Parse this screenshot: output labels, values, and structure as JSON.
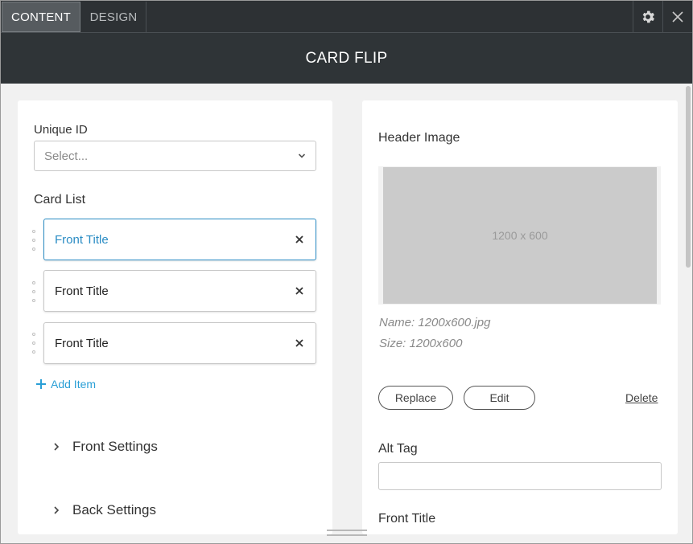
{
  "tabs": {
    "content": "CONTENT",
    "design": "DESIGN"
  },
  "header": {
    "title": "CARD FLIP"
  },
  "left": {
    "unique_id_label": "Unique ID",
    "unique_id_placeholder": "Select...",
    "card_list_label": "Card List",
    "cards": [
      {
        "title": "Front Title",
        "active": true
      },
      {
        "title": "Front Title",
        "active": false
      },
      {
        "title": "Front Title",
        "active": false
      }
    ],
    "add_item": "Add Item",
    "sections": [
      "Front Settings",
      "Back Settings"
    ]
  },
  "right": {
    "header_image_label": "Header Image",
    "image_placeholder": "1200 x 600",
    "image_name": "Name: 1200x600.jpg",
    "image_size": "Size: 1200x600",
    "replace_label": "Replace",
    "edit_label": "Edit",
    "delete_label": "Delete",
    "alt_tag_label": "Alt Tag",
    "alt_tag_value": "",
    "front_title_label": "Front Title"
  },
  "colors": {
    "accent": "#2a9fd6",
    "dark_bar": "#2f3437",
    "active_card_border": "#2a8cc4"
  },
  "icons": {
    "settings": "gear-icon",
    "close": "close-icon",
    "dropdown": "chevron-down-icon",
    "remove": "x-icon",
    "add": "plus-icon",
    "expand": "chevron-right-icon",
    "drag": "drag-handle-icon"
  }
}
